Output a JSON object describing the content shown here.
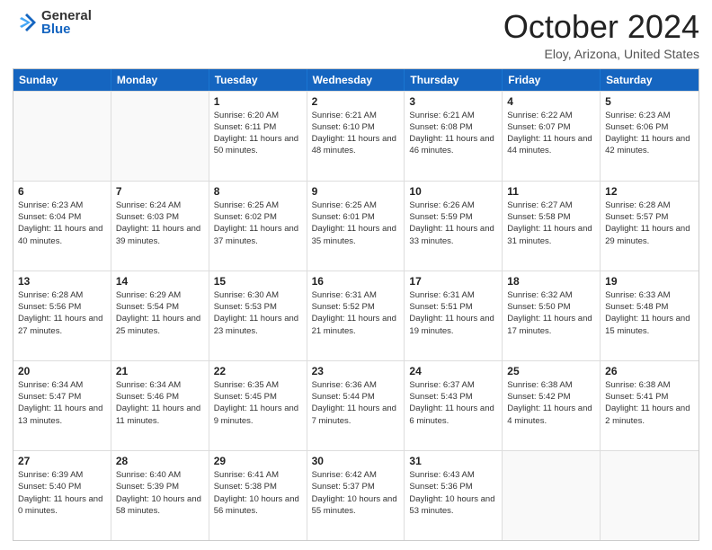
{
  "logo": {
    "general": "General",
    "blue": "Blue"
  },
  "title": "October 2024",
  "location": "Eloy, Arizona, United States",
  "days_of_week": [
    "Sunday",
    "Monday",
    "Tuesday",
    "Wednesday",
    "Thursday",
    "Friday",
    "Saturday"
  ],
  "rows": [
    [
      {
        "day": "",
        "info": ""
      },
      {
        "day": "",
        "info": ""
      },
      {
        "day": "1",
        "info": "Sunrise: 6:20 AM\nSunset: 6:11 PM\nDaylight: 11 hours and 50 minutes."
      },
      {
        "day": "2",
        "info": "Sunrise: 6:21 AM\nSunset: 6:10 PM\nDaylight: 11 hours and 48 minutes."
      },
      {
        "day": "3",
        "info": "Sunrise: 6:21 AM\nSunset: 6:08 PM\nDaylight: 11 hours and 46 minutes."
      },
      {
        "day": "4",
        "info": "Sunrise: 6:22 AM\nSunset: 6:07 PM\nDaylight: 11 hours and 44 minutes."
      },
      {
        "day": "5",
        "info": "Sunrise: 6:23 AM\nSunset: 6:06 PM\nDaylight: 11 hours and 42 minutes."
      }
    ],
    [
      {
        "day": "6",
        "info": "Sunrise: 6:23 AM\nSunset: 6:04 PM\nDaylight: 11 hours and 40 minutes."
      },
      {
        "day": "7",
        "info": "Sunrise: 6:24 AM\nSunset: 6:03 PM\nDaylight: 11 hours and 39 minutes."
      },
      {
        "day": "8",
        "info": "Sunrise: 6:25 AM\nSunset: 6:02 PM\nDaylight: 11 hours and 37 minutes."
      },
      {
        "day": "9",
        "info": "Sunrise: 6:25 AM\nSunset: 6:01 PM\nDaylight: 11 hours and 35 minutes."
      },
      {
        "day": "10",
        "info": "Sunrise: 6:26 AM\nSunset: 5:59 PM\nDaylight: 11 hours and 33 minutes."
      },
      {
        "day": "11",
        "info": "Sunrise: 6:27 AM\nSunset: 5:58 PM\nDaylight: 11 hours and 31 minutes."
      },
      {
        "day": "12",
        "info": "Sunrise: 6:28 AM\nSunset: 5:57 PM\nDaylight: 11 hours and 29 minutes."
      }
    ],
    [
      {
        "day": "13",
        "info": "Sunrise: 6:28 AM\nSunset: 5:56 PM\nDaylight: 11 hours and 27 minutes."
      },
      {
        "day": "14",
        "info": "Sunrise: 6:29 AM\nSunset: 5:54 PM\nDaylight: 11 hours and 25 minutes."
      },
      {
        "day": "15",
        "info": "Sunrise: 6:30 AM\nSunset: 5:53 PM\nDaylight: 11 hours and 23 minutes."
      },
      {
        "day": "16",
        "info": "Sunrise: 6:31 AM\nSunset: 5:52 PM\nDaylight: 11 hours and 21 minutes."
      },
      {
        "day": "17",
        "info": "Sunrise: 6:31 AM\nSunset: 5:51 PM\nDaylight: 11 hours and 19 minutes."
      },
      {
        "day": "18",
        "info": "Sunrise: 6:32 AM\nSunset: 5:50 PM\nDaylight: 11 hours and 17 minutes."
      },
      {
        "day": "19",
        "info": "Sunrise: 6:33 AM\nSunset: 5:48 PM\nDaylight: 11 hours and 15 minutes."
      }
    ],
    [
      {
        "day": "20",
        "info": "Sunrise: 6:34 AM\nSunset: 5:47 PM\nDaylight: 11 hours and 13 minutes."
      },
      {
        "day": "21",
        "info": "Sunrise: 6:34 AM\nSunset: 5:46 PM\nDaylight: 11 hours and 11 minutes."
      },
      {
        "day": "22",
        "info": "Sunrise: 6:35 AM\nSunset: 5:45 PM\nDaylight: 11 hours and 9 minutes."
      },
      {
        "day": "23",
        "info": "Sunrise: 6:36 AM\nSunset: 5:44 PM\nDaylight: 11 hours and 7 minutes."
      },
      {
        "day": "24",
        "info": "Sunrise: 6:37 AM\nSunset: 5:43 PM\nDaylight: 11 hours and 6 minutes."
      },
      {
        "day": "25",
        "info": "Sunrise: 6:38 AM\nSunset: 5:42 PM\nDaylight: 11 hours and 4 minutes."
      },
      {
        "day": "26",
        "info": "Sunrise: 6:38 AM\nSunset: 5:41 PM\nDaylight: 11 hours and 2 minutes."
      }
    ],
    [
      {
        "day": "27",
        "info": "Sunrise: 6:39 AM\nSunset: 5:40 PM\nDaylight: 11 hours and 0 minutes."
      },
      {
        "day": "28",
        "info": "Sunrise: 6:40 AM\nSunset: 5:39 PM\nDaylight: 10 hours and 58 minutes."
      },
      {
        "day": "29",
        "info": "Sunrise: 6:41 AM\nSunset: 5:38 PM\nDaylight: 10 hours and 56 minutes."
      },
      {
        "day": "30",
        "info": "Sunrise: 6:42 AM\nSunset: 5:37 PM\nDaylight: 10 hours and 55 minutes."
      },
      {
        "day": "31",
        "info": "Sunrise: 6:43 AM\nSunset: 5:36 PM\nDaylight: 10 hours and 53 minutes."
      },
      {
        "day": "",
        "info": ""
      },
      {
        "day": "",
        "info": ""
      }
    ]
  ]
}
